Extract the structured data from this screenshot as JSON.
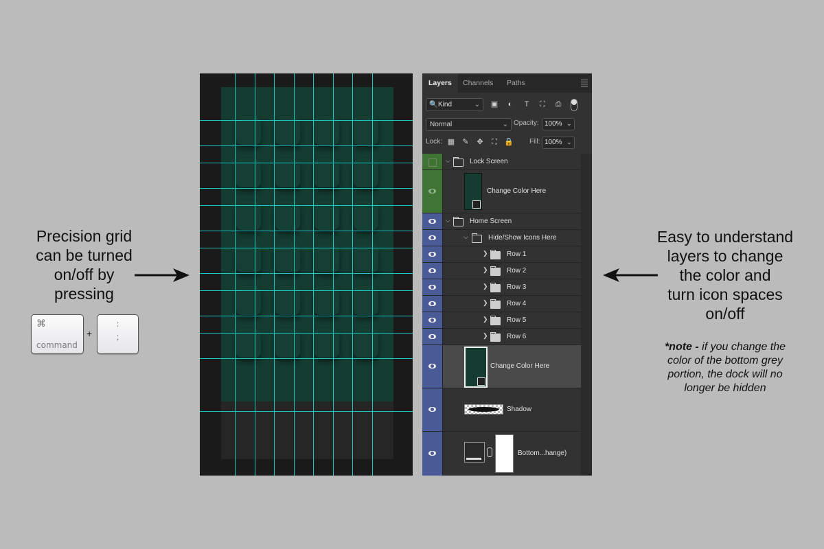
{
  "left_caption": {
    "lines": [
      "Precision grid",
      "can be turned",
      "on/off by",
      "pressing"
    ],
    "keys": {
      "command_symbol": "⌘",
      "command_label": "command",
      "plus": "+",
      "semicolon_top": ":",
      "semicolon_bottom": ";"
    }
  },
  "panel": {
    "tabs": [
      "Layers",
      "Channels",
      "Paths"
    ],
    "filter": {
      "label": "Kind",
      "search_icon": "🔍"
    },
    "blend_mode": "Normal",
    "opacity_label": "Opacity:",
    "opacity_value": "100%",
    "lock_label": "Lock:",
    "fill_label": "Fill:",
    "fill_value": "100%",
    "layers": {
      "lock_screen": "Lock Screen",
      "lock_change_color": "Change Color Here",
      "home_screen": "Home Screen",
      "hide_show": "Hide/Show Icons Here",
      "rows": [
        "Row 1",
        "Row 2",
        "Row 3",
        "Row 4",
        "Row 5",
        "Row 6"
      ],
      "home_change_color": "Change Color Here",
      "shadow": "Shadow",
      "bottom": "Bottom...hange)"
    }
  },
  "right_caption": {
    "lines": [
      "Easy to understand",
      "layers to change",
      "the color and",
      "turn icon spaces",
      "on/off"
    ],
    "note_bold": "*note - ",
    "note_text": "if you change the color of the bottom grey portion, the dock will no longer be hidden"
  },
  "colors": {
    "grid": "#19c7c3",
    "screen_green": "#143c31",
    "eye_blue": "#4a5a96",
    "eye_green": "#3f7435"
  }
}
